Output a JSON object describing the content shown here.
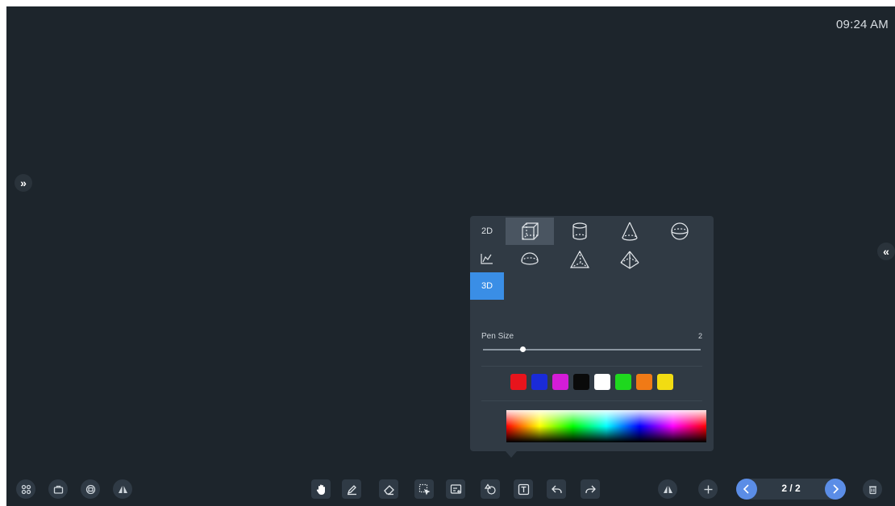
{
  "status": {
    "time": "09:24 AM"
  },
  "edges": {
    "expand_left_glyph": "»",
    "expand_right_glyph": "«"
  },
  "shape_panel": {
    "categories": [
      {
        "label": "2D",
        "icon": "2d-text"
      },
      {
        "label": "",
        "icon": "chart-icon"
      },
      {
        "label": "3D",
        "icon": "3d-text",
        "active": true
      }
    ],
    "shapes": [
      {
        "name": "cube",
        "selected": true
      },
      {
        "name": "cylinder"
      },
      {
        "name": "cone"
      },
      {
        "name": "sphere"
      },
      {
        "name": "hemisphere"
      },
      {
        "name": "triangular-pyramid"
      },
      {
        "name": "square-pyramid"
      }
    ],
    "pen_size_label": "Pen Size",
    "pen_size_value": "2",
    "pen_size_level": 0.18,
    "colors": [
      "#e8141c",
      "#1a2bd8",
      "#d41cd8",
      "#0a0a0a",
      "#ffffff",
      "#1ed81e",
      "#f07a16",
      "#f2dc12"
    ]
  },
  "toolbar": {
    "left": [
      "apps-icon",
      "toolbox-icon",
      "window-icon",
      "mirror-icon"
    ],
    "center": [
      "hand-icon",
      "pen-icon",
      "eraser-icon",
      "select-icon",
      "insert-icon",
      "shapes-icon",
      "text-icon",
      "undo-icon",
      "redo-icon"
    ],
    "right": [
      "mirror-icon",
      "add-page-icon"
    ]
  },
  "pager": {
    "label": "2 / 2"
  }
}
